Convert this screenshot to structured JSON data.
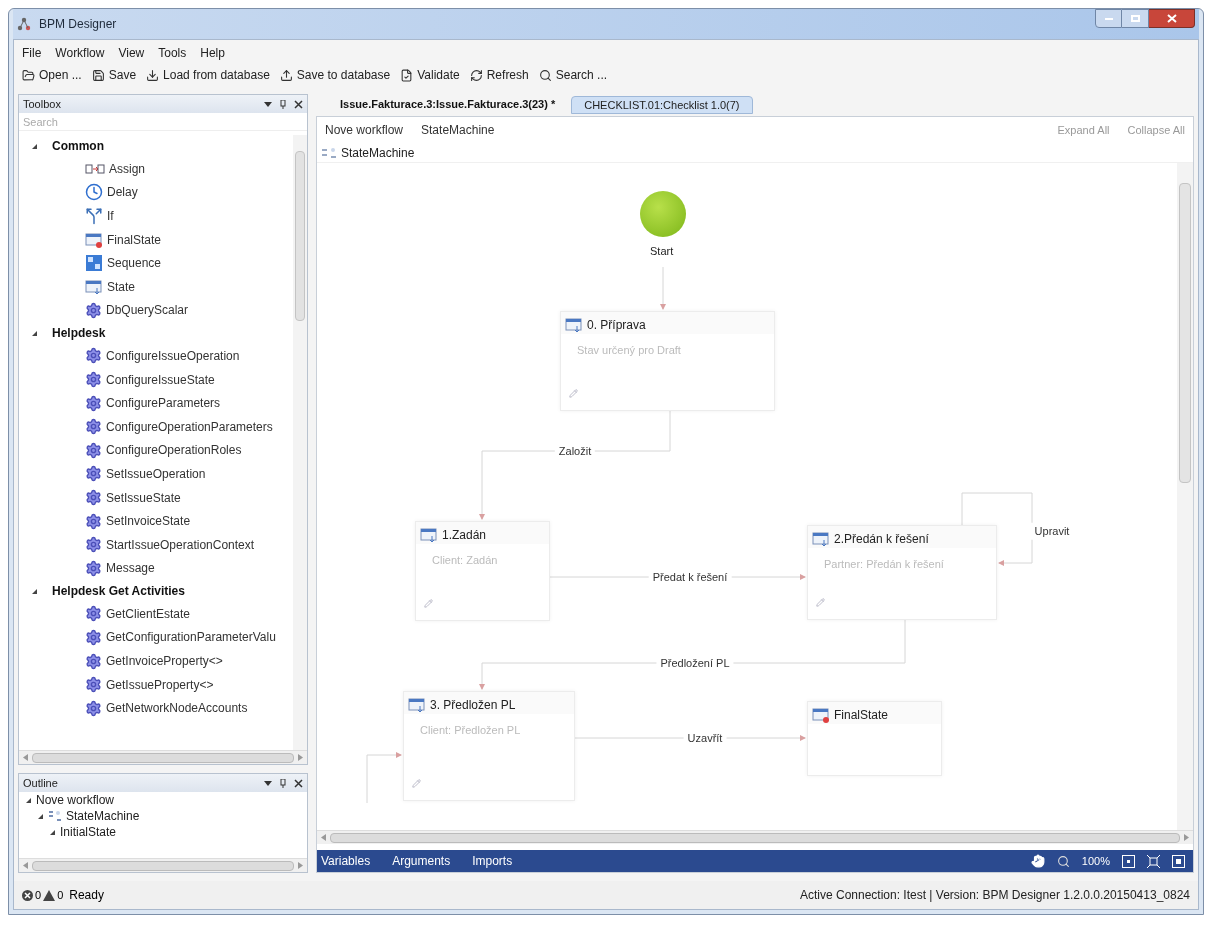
{
  "window": {
    "title": "BPM Designer"
  },
  "menu": [
    "File",
    "Workflow",
    "View",
    "Tools",
    "Help"
  ],
  "toolbar": [
    {
      "label": "Open ...",
      "kind": "open"
    },
    {
      "label": "Save",
      "kind": "save"
    },
    {
      "label": "Load from database",
      "kind": "load"
    },
    {
      "label": "Save to database",
      "kind": "store"
    },
    {
      "label": "Validate",
      "kind": "validate"
    },
    {
      "label": "Refresh",
      "kind": "refresh"
    },
    {
      "label": "Search ...",
      "kind": "search"
    }
  ],
  "toolbox": {
    "title": "Toolbox",
    "search": {
      "placeholder": "Search"
    },
    "groups": [
      {
        "label": "Common",
        "expanded": true,
        "items": [
          {
            "label": "Assign",
            "kind": "assign"
          },
          {
            "label": "Delay",
            "kind": "delay"
          },
          {
            "label": "If",
            "kind": "if"
          },
          {
            "label": "FinalState",
            "kind": "final"
          },
          {
            "label": "Sequence",
            "kind": "sequence"
          },
          {
            "label": "State",
            "kind": "state"
          },
          {
            "label": "DbQueryScalar",
            "kind": "activity"
          }
        ]
      },
      {
        "label": "Helpdesk",
        "expanded": true,
        "items": [
          {
            "label": "ConfigureIssueOperation",
            "kind": "activity"
          },
          {
            "label": "ConfigureIssueState",
            "kind": "activity"
          },
          {
            "label": "ConfigureParameters",
            "kind": "activity"
          },
          {
            "label": "ConfigureOperationParameters",
            "kind": "activity"
          },
          {
            "label": "ConfigureOperationRoles",
            "kind": "activity"
          },
          {
            "label": "SetIssueOperation",
            "kind": "activity"
          },
          {
            "label": "SetIssueState",
            "kind": "activity"
          },
          {
            "label": "SetInvoiceState",
            "kind": "activity"
          },
          {
            "label": "StartIssueOperationContext",
            "kind": "activity"
          },
          {
            "label": "Message",
            "kind": "activity"
          }
        ]
      },
      {
        "label": "Helpdesk Get Activities",
        "expanded": true,
        "items": [
          {
            "label": "GetClientEstate",
            "kind": "activity"
          },
          {
            "label": "GetConfigurationParameterValu",
            "kind": "activity"
          },
          {
            "label": "GetInvoiceProperty<>",
            "kind": "activity"
          },
          {
            "label": "GetIssueProperty<>",
            "kind": "activity"
          },
          {
            "label": "GetNetworkNodeAccounts",
            "kind": "activity"
          }
        ]
      }
    ]
  },
  "outline": {
    "title": "Outline",
    "tree": [
      {
        "label": "Nove workflow",
        "expanded": true,
        "children": [
          {
            "label": "StateMachine",
            "expanded": true,
            "kind": "statemachine",
            "children": [
              {
                "label": "InitialState",
                "expanded": true
              }
            ]
          }
        ]
      }
    ]
  },
  "tabs": [
    {
      "label": "Issue.Fakturace.3:Issue.Fakturace.3(23) *",
      "selected": true
    },
    {
      "label": "CHECKLIST.01:Checklist 1.0(7)",
      "selected": false
    }
  ],
  "breadcrumb": [
    "Nove workflow",
    "StateMachine"
  ],
  "expand_all": "Expand All",
  "collapse_all": "Collapse All",
  "designer": {
    "root": "StateMachine",
    "start": "Start",
    "states": [
      {
        "title": "0. Příprava",
        "subtitle": "Stav určený pro Draft",
        "kind": "state"
      },
      {
        "title": "1.Zadán",
        "subtitle": "Client: Zadán",
        "kind": "state"
      },
      {
        "title": "2.Předán k řešení",
        "subtitle": "Partner: Předán k řešení",
        "kind": "state"
      },
      {
        "title": "3. Předložen PL",
        "subtitle": "Client: Předložen PL",
        "kind": "state"
      },
      {
        "title": "FinalState",
        "kind": "final"
      }
    ],
    "transitions": [
      "Založit",
      "Předat k řešení",
      "Upravit",
      "Předložení PL",
      "Uzavřít"
    ]
  },
  "bottom_bar": {
    "tabs": [
      "Variables",
      "Arguments",
      "Imports"
    ],
    "zoom": "100%"
  },
  "status": {
    "errors": "0",
    "warnings": "0",
    "message": "Ready",
    "connection": "Active Connection: Itest | Version: BPM Designer 1.2.0.0.20150413_0824"
  }
}
